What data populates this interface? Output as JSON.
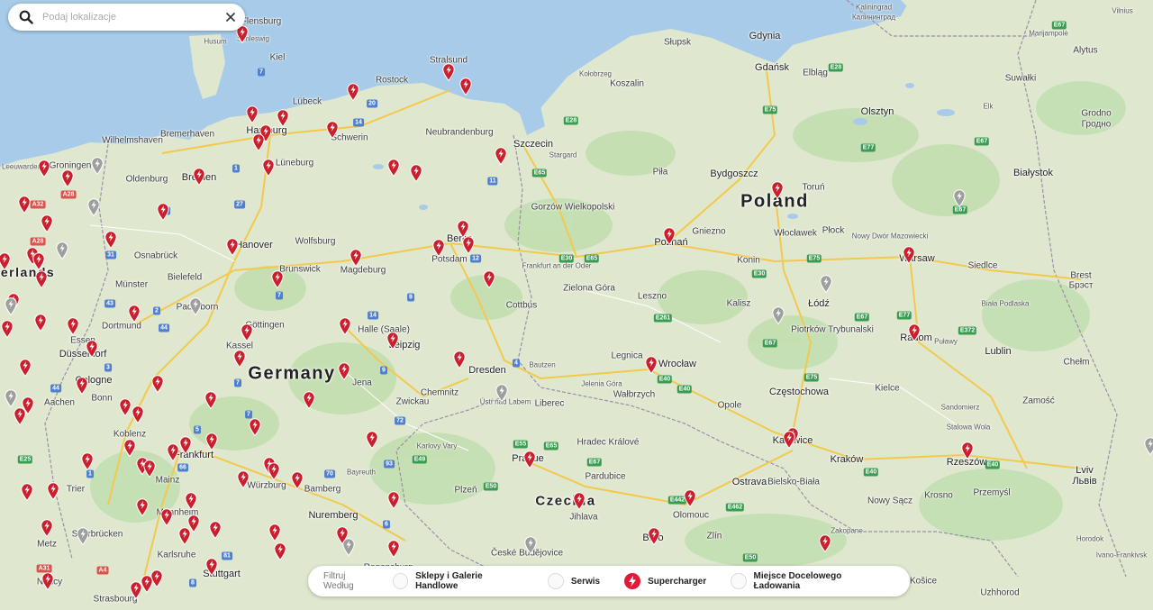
{
  "search": {
    "placeholder": "Podaj lokalizacje"
  },
  "filter": {
    "label": "Filtruj Według",
    "options": [
      {
        "label": "Sklepy i Galerie Handlowe",
        "active": false
      },
      {
        "label": "Serwis",
        "active": false
      },
      {
        "label": "Supercharger",
        "active": true
      },
      {
        "label": "Miejsce Docelowego Ładowania",
        "active": false
      }
    ]
  },
  "map": {
    "colors": {
      "land": "#dfe8cf",
      "water": "#a7cbe8",
      "forest": "#c3dfb1",
      "road": "#f2c94c",
      "border": "#9a8fa8",
      "supercharger_pin": "#cc1f2d",
      "service_pin": "#9e9e9e"
    },
    "countries": [
      {
        "name": "Poland"
      },
      {
        "name": "Germany"
      },
      {
        "name": "Czechia"
      },
      {
        "name": "nerlands"
      }
    ],
    "places": [
      "Kaliningrad",
      "Калининград",
      "Gdynia",
      "Gdańsk",
      "Elbląg",
      "Słupsk",
      "Koszalin",
      "Kołobrzeg",
      "Kiel",
      "Lübeck",
      "Rostock",
      "Stralsund",
      "Husum",
      "Schleswig",
      "Flensburg",
      "Hamburg",
      "Bremerhaven",
      "Wilhelmshaven",
      "Groningen",
      "Leeuwarden",
      "Oldenburg",
      "Bremen",
      "Schwerin",
      "Neubrandenburg",
      "Lüneburg",
      "Szczecin",
      "Stargard",
      "Piła",
      "Bydgoszcz",
      "Toruń",
      "Olsztyn",
      "Elk",
      "Suwałki",
      "Białystok",
      "Grodno",
      "Гродно",
      "Alytus",
      "Marijampolė",
      "Vilnius",
      "Hanover",
      "Wolfsburg",
      "Osnabrück",
      "Bielefeld",
      "Münster",
      "Brunswick",
      "Magdeburg",
      "Berlin",
      "Potsdam",
      "Frankfurt an der Oder",
      "Gorzów Wielkopolski",
      "Poznań",
      "Gniezno",
      "Włocławek",
      "Płock",
      "Nowy Dwór Mazowiecki",
      "Warsaw",
      "Siedlce",
      "Biała Podlaska",
      "Brest",
      "Брэст",
      "Konin",
      "Łódź",
      "Kalisz",
      "Leszno",
      "Zielona Góra",
      "Cottbus",
      "Halle (Saale)",
      "Leipzig",
      "Göttingen",
      "Kassel",
      "Paderborn",
      "Dortmund",
      "Essen",
      "Düsseldorf",
      "Cologne",
      "Bonn",
      "Aachen",
      "Koblenz",
      "Frankfurt",
      "Mainz",
      "Trier",
      "Mannheim",
      "Karlsruhe",
      "Stuttgart",
      "Strasbourg",
      "Metz",
      "Saarbrücken",
      "Nancy",
      "Würzburg",
      "Bamberg",
      "Nuremberg",
      "Bayreuth",
      "Regensburg",
      "Jena",
      "Chemnitz",
      "Zwickau",
      "Dresden",
      "Bautzen",
      "Ústí nad Labem",
      "Liberec",
      "Legnica",
      "Wrocław",
      "Wałbrzych",
      "Jelenia Góra",
      "Karlovy Vary",
      "Plzeň",
      "Prague",
      "Hradec Králové",
      "Pardubice",
      "Olomouc",
      "Ostrava",
      "Opole",
      "Częstochowa",
      "Katowice",
      "Bielsko-Biała",
      "Kraków",
      "Kielce",
      "Radom",
      "Piotrków Trybunalski",
      "Lublin",
      "Puławy",
      "Chełm",
      "Zamość",
      "Sandomierz",
      "Stalowa Wola",
      "Rzeszów",
      "Przemyśl",
      "Krosno",
      "Nowy Sącz",
      "Zakopane",
      "Lviv",
      "Львів",
      "Ivano-Frankivsk",
      "Košice",
      "Uzhhorod",
      "Zlín",
      "Brno",
      "České Budějovice",
      "Jihlava",
      "Horodok"
    ]
  }
}
